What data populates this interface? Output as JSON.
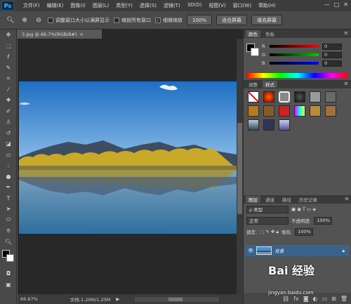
{
  "app": {
    "logo": "Ps"
  },
  "menus": [
    "文件(F)",
    "编辑(E)",
    "图像(I)",
    "图层(L)",
    "类型(Y)",
    "选择(S)",
    "滤镜(T)",
    "3D(D)",
    "视图(V)",
    "窗口(W)",
    "帮助(H)"
  ],
  "window_controls": [
    "—",
    "□",
    "✕"
  ],
  "options": {
    "resize_windows": "调整窗口大小以满屏显示",
    "zoom_all": "缩放所有窗口",
    "scrubby_zoom": "细微缩放",
    "btn_100": "100%",
    "btn_fit": "适合屏幕",
    "btn_fill": "填充屏幕"
  },
  "document": {
    "tab_title": "3.jpg @ 66.7%(RGB/8#)",
    "close": "×"
  },
  "status": {
    "zoom": "66.67%",
    "doc_size": "文档:1.20M/1.20M",
    "arrow": "▶"
  },
  "color_panel": {
    "tabs": [
      "颜色",
      "色板"
    ],
    "r_label": "R",
    "g_label": "G",
    "b_label": "B",
    "r": "0",
    "g": "0",
    "b": "0"
  },
  "adjust_panel": {
    "tabs": [
      "调整",
      "样式"
    ]
  },
  "layers_panel": {
    "tabs": [
      "图层",
      "通道",
      "路径",
      "历史记录"
    ],
    "kind": "ρ 类型",
    "blend": "正常",
    "opacity_label": "不透明度:",
    "opacity": "100%",
    "lock_label": "锁定:",
    "fill_label": "填充:",
    "fill": "100%",
    "layer_name": "背景"
  },
  "colors": {
    "accent": "#39638b",
    "bg": "#535353"
  },
  "watermark": {
    "brand": "Bai 经验",
    "url": "jingyan.baidu.com"
  }
}
